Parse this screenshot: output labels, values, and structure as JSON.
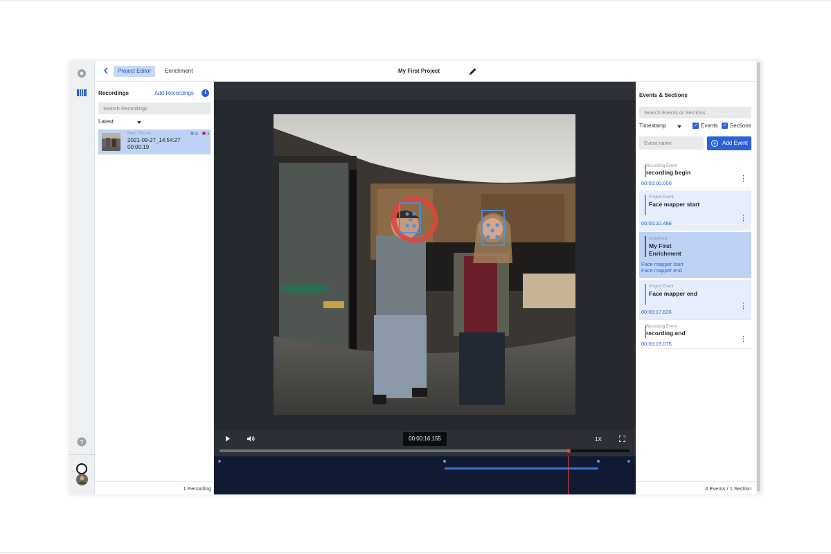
{
  "header": {
    "tabs": [
      {
        "label": "Project Editor",
        "active": true
      },
      {
        "label": "Enrichment",
        "active": false
      }
    ],
    "project_title": "My First Project"
  },
  "recordings": {
    "title": "Recordings",
    "add_label": "Add Recordings",
    "search_placeholder": "Search Recordings",
    "sort_label": "Latest",
    "items": [
      {
        "user": "Marc Tonsen",
        "date": "2021-09-27_14:54:27",
        "duration": "00:00:19",
        "event_count": "2",
        "section_count": "1"
      }
    ],
    "footer": "1 Recording"
  },
  "player": {
    "timecode": "00:00:16.155",
    "speed": "1X",
    "progress_fraction": 0.852
  },
  "events_panel": {
    "title": "Events & Sections",
    "search_placeholder": "Search Events or Sections",
    "sort_label": "Timestamp",
    "filter_events": "Events",
    "filter_sections": "Sections",
    "event_name_placeholder": "Event name",
    "add_event_label": "Add Event",
    "events": [
      {
        "type": "Recording Event",
        "name": "recording.begin",
        "timestamp": "00:00:00.000"
      },
      {
        "type": "Project Event",
        "name": "Face mapper start",
        "timestamp": "00:00:10.486"
      },
      {
        "type": "undefined",
        "name": "My First Enrichment",
        "start": "Face mapper start",
        "end": "Face mapper end"
      },
      {
        "type": "Project Event",
        "name": "Face mapper end",
        "timestamp": "00:00:17.626"
      },
      {
        "type": "Recording Event",
        "name": "recording.end",
        "timestamp": "00:00:19.075"
      }
    ],
    "footer": "4 Events / 1 Section"
  },
  "colors": {
    "accent": "#2962d9",
    "recording_event": "#5aa0e6",
    "project_event": "#5aa0e6",
    "enrichment": "#b0306a",
    "playhead": "#e0463a",
    "timeline_bg": "#121a33"
  }
}
